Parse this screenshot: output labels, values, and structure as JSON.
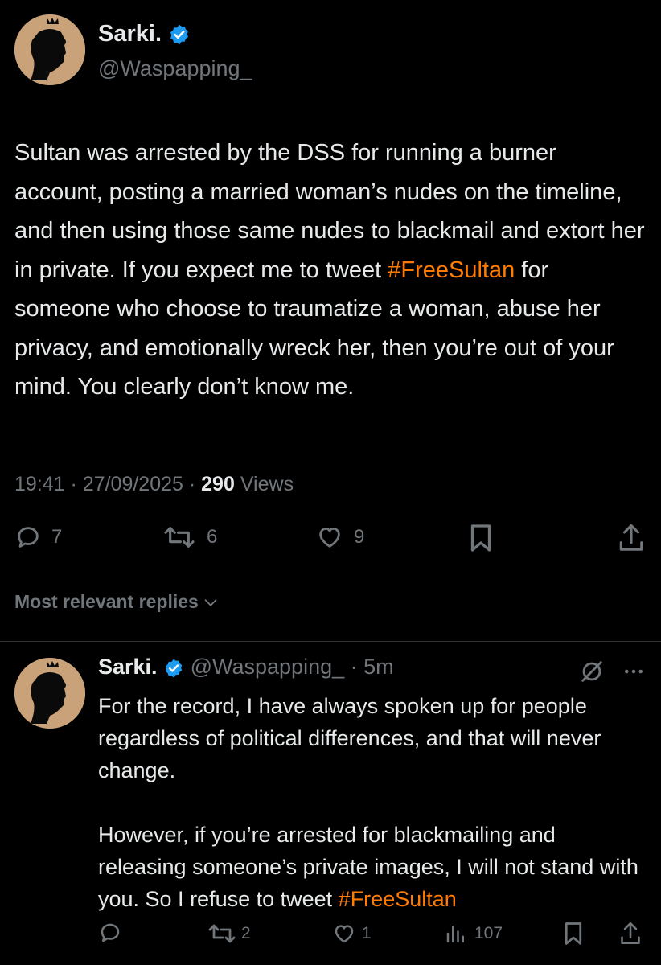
{
  "main_tweet": {
    "author_name": "Sarki.",
    "handle": "@Waspapping_",
    "text_before": "Sultan was arrested by the DSS for running a burner account, posting a married woman’s nudes on the timeline, and then using those same nudes to blackmail and extort her in private. If you expect me to tweet ",
    "hashtag": "#FreeSultan",
    "text_after": " for someone who choose to traumatize a woman, abuse her privacy, and emotionally wreck her, then you’re out of your mind. You clearly don’t know me.",
    "time": "19:41",
    "date": "27/09/2025",
    "views_count": "290",
    "views_label": "Views",
    "replies": "7",
    "reposts": "6",
    "likes": "9"
  },
  "replies_section": {
    "label": "Most relevant replies"
  },
  "reply": {
    "author_name": "Sarki.",
    "handle": "@Waspapping_",
    "age": "5m",
    "paragraph1": "For the record, I have always spoken up for people regardless of political differences, and that will never change.",
    "paragraph2_before": "However, if you’re arrested for blackmailing and releasing someone’s private images, I will not stand with you. So I refuse to tweet ",
    "hashtag": "#FreeSultan",
    "replies": "",
    "reposts": "2",
    "likes": "1",
    "views": "107"
  },
  "colors": {
    "background": "#000000",
    "text": "#e7e9ea",
    "muted": "#71767b",
    "hashtag": "#ff7a00",
    "verified": "#1d9bf0"
  },
  "icons": [
    "verified-badge-icon",
    "reply-icon",
    "repost-icon",
    "like-icon",
    "bookmark-icon",
    "share-icon",
    "chevron-down-icon",
    "mute-icon",
    "more-icon",
    "views-icon"
  ]
}
